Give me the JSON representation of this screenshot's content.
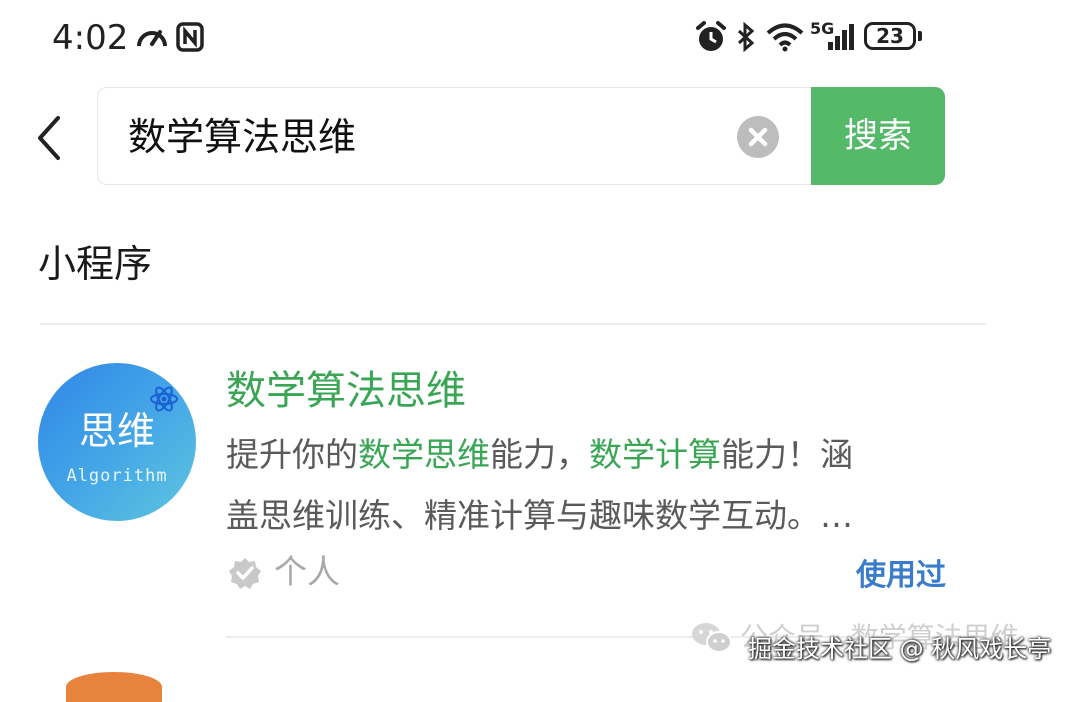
{
  "status_bar": {
    "time": "4:02",
    "network": "5G",
    "battery": "23"
  },
  "search": {
    "back_icon": "chevron-left-icon",
    "query": "数学算法思维",
    "clear_icon": "clear-circle-icon",
    "button_label": "搜索"
  },
  "section": {
    "title": "小程序"
  },
  "result": {
    "logo_text": "思维",
    "logo_subtext": "Algorithm",
    "title": "数学算法思维",
    "description_parts": [
      "提升你的",
      "数学思维",
      "能力，",
      "数学计算",
      "能力！涵"
    ],
    "description_line2": "盖思维训练、精准计算与趣味数学互动。…",
    "author": "个人",
    "used_label": "使用过"
  },
  "watermarks": {
    "account": "公众号 · 数学算法思维",
    "platform": "掘金技术社区 @ 秋风戏长亭"
  },
  "colors": {
    "accent_green": "#55b96a",
    "highlight_green": "#3aa655",
    "link_blue": "#3a7cc9"
  }
}
